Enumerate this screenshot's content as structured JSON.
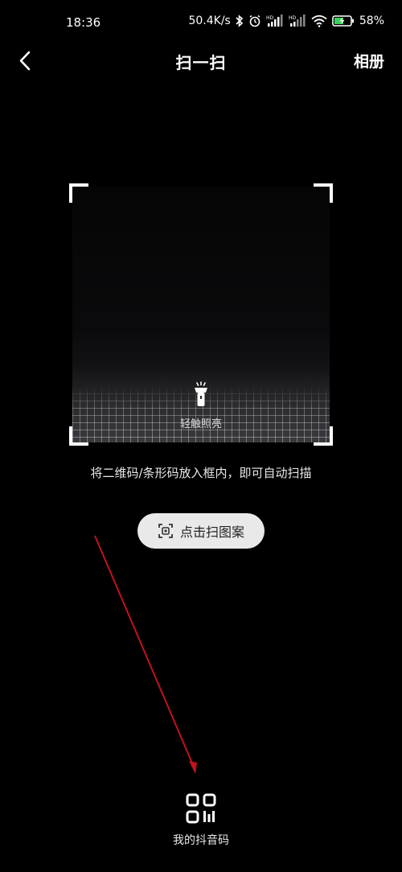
{
  "status_bar": {
    "time": "18:36",
    "network_speed": "50.4K/s",
    "battery_percent": "58",
    "battery_suffix": "%",
    "icons": [
      "bluetooth-icon",
      "alarm-icon",
      "hd-signal-icon",
      "hd-signal-icon",
      "wifi-icon",
      "battery-charging-icon"
    ]
  },
  "header": {
    "back_icon": "chevron-left-icon",
    "title": "扫一扫",
    "album_label": "相册"
  },
  "scanner": {
    "flashlight_label": "轻触照亮",
    "hint": "将二维码/条形码放入框内，即可自动扫描"
  },
  "scan_image_button": {
    "icon": "scan-image-icon",
    "label": "点击扫图案"
  },
  "my_code": {
    "icon": "qr-code-icon",
    "label": "我的抖音码"
  },
  "annotation": {
    "arrow_color": "#c0141c"
  }
}
